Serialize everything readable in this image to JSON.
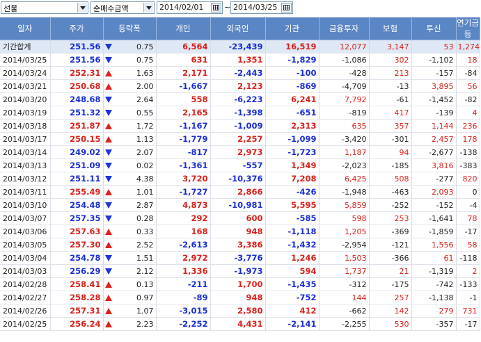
{
  "toolbar": {
    "market_select": "선물",
    "metric_select": "순매수금액",
    "start_date": "2014/02/01",
    "end_date": "2014/03/25",
    "range_separator": "~"
  },
  "columns": [
    "일자",
    "주가",
    "등락폭",
    "개인",
    "외국인",
    "기관",
    "금융투자",
    "보험",
    "투신",
    "연기금등"
  ],
  "colors": {
    "header_bg": "#5b86c4",
    "up": "#d9211c",
    "down": "#1a2fd1",
    "total_bg": "#dfe8f5"
  },
  "total": {
    "label": "기간합계",
    "price": "251.56",
    "dir": "down",
    "change": "0.75",
    "individual": "6,564",
    "foreign": "-23,439",
    "institution": "16,519",
    "fin_invest": "12,077",
    "insurance": "3,147",
    "trust": "53",
    "pension": "1,274"
  },
  "rows": [
    {
      "date": "2014/03/25",
      "price": "251.56",
      "dir": "down",
      "change": "0.75",
      "individual": "631",
      "foreign": "1,351",
      "institution": "-1,829",
      "fin_invest": "-1,086",
      "insurance": "302",
      "trust": "-1,102",
      "pension": "18"
    },
    {
      "date": "2014/03/24",
      "price": "252.31",
      "dir": "up",
      "change": "1.63",
      "individual": "2,171",
      "foreign": "-2,443",
      "institution": "-100",
      "fin_invest": "-428",
      "insurance": "213",
      "trust": "-157",
      "pension": "-84"
    },
    {
      "date": "2014/03/21",
      "price": "250.68",
      "dir": "up",
      "change": "2.00",
      "individual": "-1,667",
      "foreign": "2,123",
      "institution": "-869",
      "fin_invest": "-4,709",
      "insurance": "-13",
      "trust": "3,895",
      "pension": "56"
    },
    {
      "date": "2014/03/20",
      "price": "248.68",
      "dir": "down",
      "change": "2.64",
      "individual": "558",
      "foreign": "-6,223",
      "institution": "6,241",
      "fin_invest": "7,792",
      "insurance": "-61",
      "trust": "-1,452",
      "pension": "-82"
    },
    {
      "date": "2014/03/19",
      "price": "251.32",
      "dir": "down",
      "change": "0.55",
      "individual": "2,165",
      "foreign": "-1,398",
      "institution": "-651",
      "fin_invest": "-819",
      "insurance": "417",
      "trust": "-139",
      "pension": "4"
    },
    {
      "date": "2014/03/18",
      "price": "251.87",
      "dir": "up",
      "change": "1.72",
      "individual": "-1,167",
      "foreign": "-1,009",
      "institution": "2,313",
      "fin_invest": "635",
      "insurance": "357",
      "trust": "1,144",
      "pension": "236"
    },
    {
      "date": "2014/03/17",
      "price": "250.15",
      "dir": "up",
      "change": "1.13",
      "individual": "-1,779",
      "foreign": "2,257",
      "institution": "-1,099",
      "fin_invest": "-3,420",
      "insurance": "-301",
      "trust": "2,457",
      "pension": "178"
    },
    {
      "date": "2014/03/14",
      "price": "249.02",
      "dir": "down",
      "change": "2.07",
      "individual": "-817",
      "foreign": "2,973",
      "institution": "-1,723",
      "fin_invest": "1,187",
      "insurance": "94",
      "trust": "-2,677",
      "pension": "-138"
    },
    {
      "date": "2014/03/13",
      "price": "251.09",
      "dir": "down",
      "change": "0.02",
      "individual": "-1,361",
      "foreign": "-557",
      "institution": "1,349",
      "fin_invest": "-2,023",
      "insurance": "-185",
      "trust": "3,816",
      "pension": "-383"
    },
    {
      "date": "2014/03/12",
      "price": "251.11",
      "dir": "down",
      "change": "4.38",
      "individual": "3,720",
      "foreign": "-10,376",
      "institution": "7,208",
      "fin_invest": "6,425",
      "insurance": "508",
      "trust": "-277",
      "pension": "820"
    },
    {
      "date": "2014/03/11",
      "price": "255.49",
      "dir": "up",
      "change": "1.01",
      "individual": "-1,727",
      "foreign": "2,866",
      "institution": "-426",
      "fin_invest": "-1,948",
      "insurance": "-463",
      "trust": "2,093",
      "pension": "0"
    },
    {
      "date": "2014/03/10",
      "price": "254.48",
      "dir": "down",
      "change": "2.87",
      "individual": "4,873",
      "foreign": "-10,981",
      "institution": "5,595",
      "fin_invest": "5,859",
      "insurance": "-252",
      "trust": "-152",
      "pension": "-4"
    },
    {
      "date": "2014/03/07",
      "price": "257.35",
      "dir": "down",
      "change": "0.28",
      "individual": "292",
      "foreign": "600",
      "institution": "-585",
      "fin_invest": "598",
      "insurance": "253",
      "trust": "-1,641",
      "pension": "78"
    },
    {
      "date": "2014/03/06",
      "price": "257.63",
      "dir": "up",
      "change": "0.33",
      "individual": "168",
      "foreign": "948",
      "institution": "-1,118",
      "fin_invest": "1,205",
      "insurance": "-369",
      "trust": "-1,859",
      "pension": "-17"
    },
    {
      "date": "2014/03/05",
      "price": "257.30",
      "dir": "up",
      "change": "2.52",
      "individual": "-2,613",
      "foreign": "3,386",
      "institution": "-1,432",
      "fin_invest": "-2,954",
      "insurance": "-121",
      "trust": "1,556",
      "pension": "58"
    },
    {
      "date": "2014/03/04",
      "price": "254.78",
      "dir": "down",
      "change": "1.51",
      "individual": "2,972",
      "foreign": "-3,776",
      "institution": "1,246",
      "fin_invest": "1,503",
      "insurance": "-366",
      "trust": "61",
      "pension": "-118"
    },
    {
      "date": "2014/03/03",
      "price": "256.29",
      "dir": "down",
      "change": "2.12",
      "individual": "1,336",
      "foreign": "-1,973",
      "institution": "594",
      "fin_invest": "1,737",
      "insurance": "21",
      "trust": "-1,319",
      "pension": "2"
    },
    {
      "date": "2014/02/28",
      "price": "258.41",
      "dir": "up",
      "change": "0.13",
      "individual": "-211",
      "foreign": "1,700",
      "institution": "-1,435",
      "fin_invest": "-312",
      "insurance": "-175",
      "trust": "-742",
      "pension": "-133"
    },
    {
      "date": "2014/02/27",
      "price": "258.28",
      "dir": "up",
      "change": "0.97",
      "individual": "-89",
      "foreign": "948",
      "institution": "-752",
      "fin_invest": "144",
      "insurance": "257",
      "trust": "-1,138",
      "pension": "-1"
    },
    {
      "date": "2014/02/26",
      "price": "257.31",
      "dir": "up",
      "change": "1.07",
      "individual": "-3,015",
      "foreign": "2,580",
      "institution": "412",
      "fin_invest": "-662",
      "insurance": "142",
      "trust": "279",
      "pension": "731"
    },
    {
      "date": "2014/02/25",
      "price": "256.24",
      "dir": "up",
      "change": "2.23",
      "individual": "-2,252",
      "foreign": "4,431",
      "institution": "-2,141",
      "fin_invest": "-2,255",
      "insurance": "530",
      "trust": "-357",
      "pension": "-17"
    }
  ]
}
